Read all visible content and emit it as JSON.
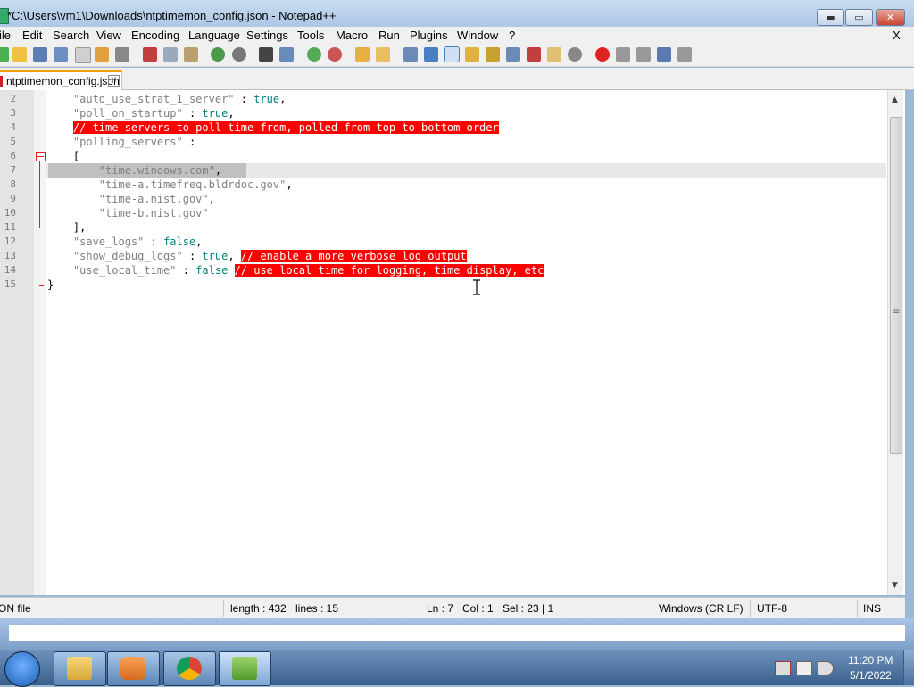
{
  "window": {
    "title": "*C:\\Users\\vm1\\Downloads\\ntptimemon_config.json - Notepad++",
    "minimize_glyph": "▬",
    "maximize_glyph": "▭",
    "close_glyph": "✕"
  },
  "menu": {
    "items": [
      "ile",
      "Edit",
      "Search",
      "View",
      "Encoding",
      "Language",
      "Settings",
      "Tools",
      "Macro",
      "Run",
      "Plugins",
      "Window",
      "?"
    ],
    "close_label": "X"
  },
  "tab": {
    "label": "ntptimemon_config.json",
    "close_glyph": "×"
  },
  "editor": {
    "line_numbers": [
      "2",
      "3",
      "4",
      "5",
      "6",
      "7",
      "8",
      "9",
      "10",
      "11",
      "12",
      "13",
      "14",
      "15"
    ],
    "lines": [
      {
        "pre": "    ",
        "str": "\"auto_use_strat_1_server\"",
        "sep": " : ",
        "val": "true",
        "tail": ",",
        "comment": ""
      },
      {
        "pre": "    ",
        "str": "\"poll_on_startup\"",
        "sep": " : ",
        "val": "true",
        "tail": ",",
        "comment": ""
      },
      {
        "pre": "    ",
        "str": "",
        "sep": "",
        "val": "",
        "tail": "",
        "comment": "// time servers to poll time from, polled from top-to-bottom order"
      },
      {
        "pre": "    ",
        "str": "\"polling_servers\"",
        "sep": " :",
        "val": "",
        "tail": "",
        "comment": ""
      },
      {
        "pre": "    ",
        "str": "",
        "sep": "[",
        "val": "",
        "tail": "",
        "comment": ""
      },
      {
        "pre": "        ",
        "str": "\"time.windows.com\"",
        "sep": ",",
        "val": "",
        "tail": "",
        "comment": ""
      },
      {
        "pre": "        ",
        "str": "\"time-a.timefreq.bldrdoc.gov\"",
        "sep": ",",
        "val": "",
        "tail": "",
        "comment": ""
      },
      {
        "pre": "        ",
        "str": "\"time-a.nist.gov\"",
        "sep": ",",
        "val": "",
        "tail": "",
        "comment": ""
      },
      {
        "pre": "        ",
        "str": "\"time-b.nist.gov\"",
        "sep": "",
        "val": "",
        "tail": "",
        "comment": ""
      },
      {
        "pre": "    ",
        "str": "",
        "sep": "],",
        "val": "",
        "tail": "",
        "comment": ""
      },
      {
        "pre": "    ",
        "str": "\"save_logs\"",
        "sep": " : ",
        "val": "false",
        "tail": ",",
        "comment": ""
      },
      {
        "pre": "    ",
        "str": "\"show_debug_logs\"",
        "sep": " : ",
        "val": "true",
        "tail": ", ",
        "comment": "// enable a more verbose log output"
      },
      {
        "pre": "    ",
        "str": "\"use_local_time\"",
        "sep": " : ",
        "val": "false",
        "tail": " ",
        "comment": "// use local time for logging, time display, etc"
      },
      {
        "pre": "",
        "str": "",
        "sep": "}",
        "val": "",
        "tail": "",
        "comment": ""
      }
    ]
  },
  "status": {
    "file_type": "ON file",
    "length": "length : 432",
    "lines": "lines : 15",
    "ln": "Ln : 7",
    "col": "Col : 1",
    "sel": "Sel : 23 | 1",
    "eol": "Windows (CR LF)",
    "encoding": "UTF-8",
    "mode": "INS"
  },
  "scrollbar": {
    "up_glyph": "▲",
    "down_glyph": "▼",
    "grip_glyph": "≡"
  },
  "taskbar": {
    "time": "11:20 PM",
    "date": "5/1/2022"
  },
  "colors": {
    "comment_bg": "#ff0000",
    "string": "#808080",
    "keyword": "#008080",
    "current_line": "#e8e8e8",
    "selection": "#c0c0c0"
  }
}
